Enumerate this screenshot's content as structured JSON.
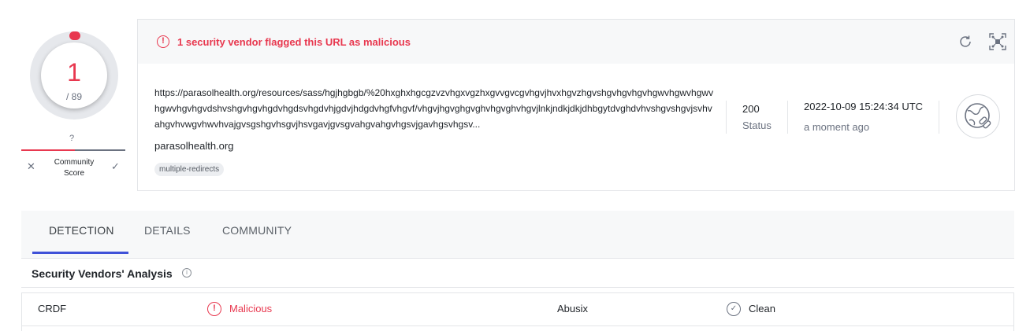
{
  "score": {
    "detections": "1",
    "total": "/ 89"
  },
  "community": {
    "unknown_mark": "?",
    "label_line1": "Community",
    "label_line2": "Score",
    "downvote_glyph": "✕",
    "upvote_glyph": "✓"
  },
  "alert": {
    "text": "1 security vendor flagged this URL as malicious",
    "icon": "alert-circle-icon",
    "color": "#e8384f"
  },
  "header_actions": {
    "reanalyze_icon": "reanalyze-icon",
    "graph_icon": "graph-icon"
  },
  "url": {
    "full": "https://parasolhealth.org/resources/sass/hgjhgbgb/%20hxghxhgcgzvzvhgxvgzhxgvvgvcgvhgvjhvxhgvzhgvshgvhgvhgvhgwvhgwvhgwvhgwvhgvhgvdshvshgvhgvhgdvhgdsvhgdvhjgdvjhdgdvhgfvhgvf/vhgvjhgvghgvghvhgvghvhgvjlnkjndkjdkjdhbgytdvghdvhvshgvshgvjsvhvahgvhvwgvhwvhvajgvsgshgvhsgvjhsvgavjgvsgvahgvahgvhgsvjgavhgsvhgsv...",
    "domain": "parasolhealth.org",
    "tag": "multiple-redirects"
  },
  "status": {
    "code": "200",
    "label": "Status"
  },
  "date": {
    "timestamp": "2022-10-09 15:24:34 UTC",
    "relative": "a moment ago"
  },
  "resource_icon": "url-globe-link-icon",
  "tabs": [
    {
      "label": "DETECTION",
      "active": true
    },
    {
      "label": "DETAILS",
      "active": false
    },
    {
      "label": "COMMUNITY",
      "active": false
    }
  ],
  "analysis": {
    "title": "Security Vendors' Analysis",
    "info_glyph": "i",
    "rows": [
      {
        "vendor_a": "CRDF",
        "result_a": "Malicious",
        "vendor_b": "Abusix",
        "result_b": "Clean"
      }
    ]
  },
  "colors": {
    "malicious": "#e8384f",
    "accent_tab": "#3f51d8",
    "muted": "#6b7280"
  }
}
